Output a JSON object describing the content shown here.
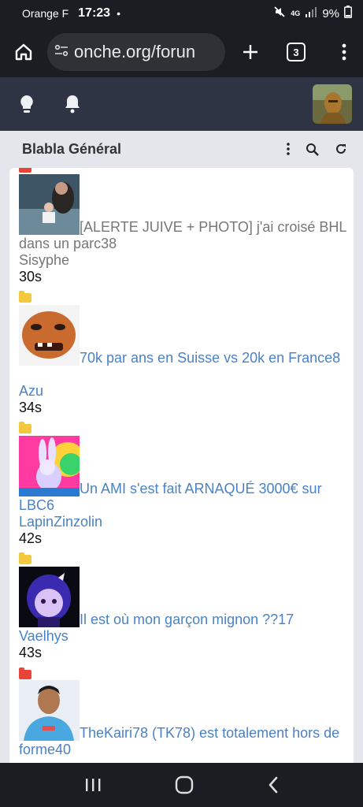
{
  "status": {
    "carrier": "Orange F",
    "time": "17:23",
    "dot": "•",
    "network": "4G",
    "battery": "9%"
  },
  "browser": {
    "url": "onche.org/forun",
    "tab_count": "3"
  },
  "forum": {
    "title": "Blabla Général"
  },
  "topics": [
    {
      "title": "[ALERTE JUIVE + PHOTO] j'ai croisé BHL dans un parc38",
      "author": "Sisyphe",
      "time": "30s",
      "read": true,
      "folder_color": "#f3c83c",
      "thumb_icon": "photo-thumbnail"
    },
    {
      "title": "70k par ans en Suisse vs 20k en France8",
      "author": "Azu",
      "time": "34s",
      "read": false,
      "folder_color": "#f3c83c",
      "thumb_icon": "face-thumbnail"
    },
    {
      "title": "Un AMI s'est fait ARNAQUÉ 3000€ sur LBC6",
      "author": "LapinZinzolin",
      "time": "42s",
      "read": false,
      "folder_color": "#f3c83c",
      "thumb_icon": "rabbit-thumbnail"
    },
    {
      "title": "Il est où mon garçon mignon ??17",
      "author": "Vaelhys",
      "time": "43s",
      "read": false,
      "folder_color": "#e8443a",
      "thumb_icon": "anime-girl-thumbnail"
    },
    {
      "title": "TheKairi78 (TK78) est totalement hors de forme40",
      "author": "",
      "time": "",
      "read": false,
      "folder_color": "",
      "thumb_icon": "footballer-thumbnail"
    }
  ],
  "colors": {
    "link": "#4b82c4",
    "read": "#777777",
    "header": "#2f3445",
    "chrome": "#1b1d22"
  }
}
